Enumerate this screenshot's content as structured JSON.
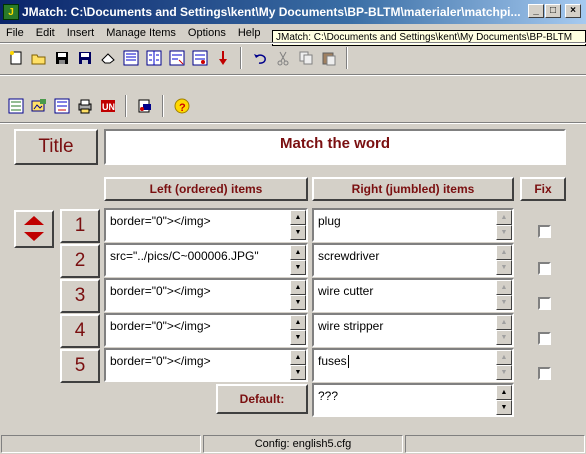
{
  "window": {
    "title": "JMatch: C:\\Documents and Settings\\kent\\My Documents\\BP-BLTM\\materialer\\matchpi...",
    "app_icon_glyph": "J",
    "minimize": "_",
    "maximize": "□",
    "close": "×"
  },
  "menu": [
    "File",
    "Edit",
    "Insert",
    "Manage Items",
    "Options",
    "Help"
  ],
  "tooltip": "JMatch: C:\\Documents and Settings\\kent\\My Documents\\BP-BLTM",
  "toolbar1": [
    "new-icon",
    "open-icon",
    "save-icon",
    "save-as-icon",
    "eraser-icon",
    "web-page-icon",
    "web-frames-icon",
    "drag-drop-icon",
    "export-icon",
    "move-down-icon",
    "undo-icon",
    "cut-icon",
    "copy-icon",
    "paste-icon"
  ],
  "toolbar2": [
    "configure-icon",
    "image-icon",
    "link-icon",
    "print-icon",
    "unicode-icon",
    "tutor-icon",
    "help-icon"
  ],
  "form": {
    "title_label": "Title",
    "title_value": "Match the word",
    "left_header": "Left (ordered) items",
    "right_header": "Right (jumbled) items",
    "fix_header": "Fix",
    "default_label": "Default:",
    "default_value": "???",
    "rows": [
      {
        "num": "1",
        "left": "border=\"0\"></img>",
        "right": "plug",
        "fixed": false
      },
      {
        "num": "2",
        "left": "src=\"../pics/C~000006.JPG\"",
        "right": "screwdriver",
        "fixed": false
      },
      {
        "num": "3",
        "left": "border=\"0\"></img>",
        "right": "wire cutter",
        "fixed": false
      },
      {
        "num": "4",
        "left": "border=\"0\"></img>",
        "right": "wire stripper",
        "fixed": false
      },
      {
        "num": "5",
        "left": "border=\"0\"></img>",
        "right": "fuses",
        "fixed": false
      }
    ]
  },
  "status": {
    "left": "",
    "middle": "Config: english5.cfg",
    "right": ""
  },
  "colors": {
    "accent": "#7a0f10",
    "face": "#d4d0c8",
    "titlebar": "#0a246a"
  }
}
